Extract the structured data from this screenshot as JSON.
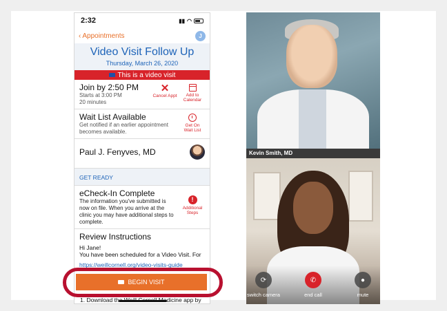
{
  "phone": {
    "status_time": "2:32",
    "nav": {
      "back_label": "Appointments",
      "avatar_initial": "J"
    },
    "header": {
      "title": "Video Visit Follow Up",
      "date": "Thursday, March 26, 2020"
    },
    "banner": "This is a video visit",
    "join": {
      "title": "Join by 2:50 PM",
      "starts": "Starts at 3:00 PM",
      "duration": "20 minutes",
      "cancel_label": "Cancel Appt",
      "calendar_label_1": "Add to",
      "calendar_label_2": "Calendar"
    },
    "waitlist": {
      "title": "Wait List Available",
      "desc_1": "Get notified if an earlier appointment",
      "desc_2": "becomes available.",
      "action_1": "Get On",
      "action_2": "Wait List"
    },
    "provider": {
      "name": "Paul J. Fenyves, MD"
    },
    "get_ready_label": "GET READY",
    "echeck": {
      "title": "eCheck-In Complete",
      "desc_1": "The information you've submitted is",
      "desc_2": "now on file. When you arrive at the",
      "desc_3": "clinic you may have additional steps to",
      "desc_4": "complete.",
      "action_1": "Additional",
      "action_2": "Steps"
    },
    "review": {
      "title": "Review Instructions",
      "greeting": "Hi Jane!",
      "line": "You have been scheduled for a Video Visit.  For",
      "link": "https://weillcornell.org/video-visits-guide"
    },
    "begin_label": "BEGIN VISIT",
    "footer_line": "1.  Download the Weill Cornell Medicine app by"
  },
  "video": {
    "doctor_name": "Kevin Smith, MD",
    "controls": {
      "switch_label": "switch camera",
      "end_label": "end call",
      "mute_label": "mute"
    }
  },
  "colors": {
    "accent": "#e8702a",
    "brand_blue": "#1d63b8",
    "alert_red": "#d8232a",
    "highlight_ring": "#b8102f"
  }
}
